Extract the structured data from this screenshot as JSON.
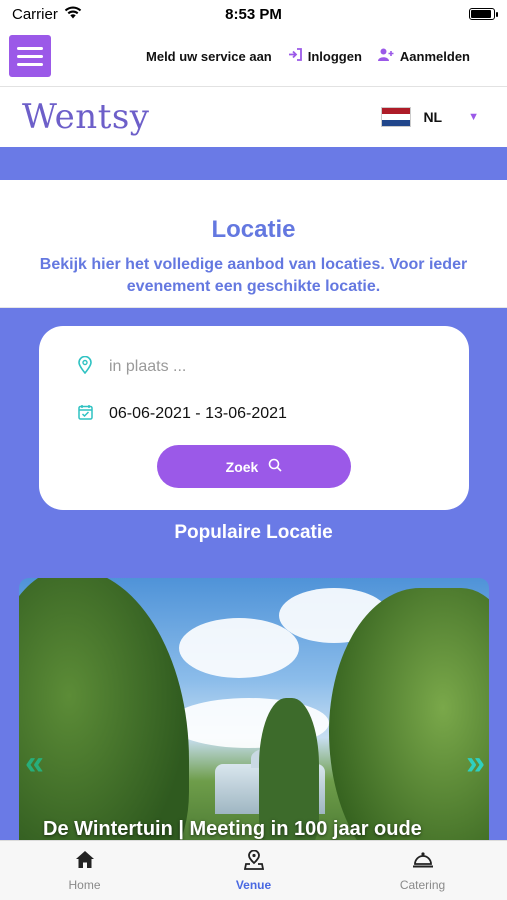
{
  "status_bar": {
    "carrier": "Carrier",
    "time": "8:53 PM",
    "wifi_icon": "wifi-icon",
    "battery_level": 0.9
  },
  "top_bar": {
    "menu_icon": "hamburger-menu-icon",
    "service_label": "Meld uw service aan",
    "login_label": "Inloggen",
    "login_icon": "login-arrow-icon",
    "register_label": "Aanmelden",
    "register_icon": "user-plus-icon"
  },
  "header": {
    "logo_text": "Wentsy",
    "language": "NL",
    "flag_colors": [
      "#AE1C28",
      "#FFFFFF",
      "#21468B"
    ],
    "dropdown_icon": "caret-down-icon"
  },
  "hero": {
    "title": "Locatie",
    "subtitle": "Bekijk hier het volledige aanbod van locaties. Voor ieder evenement een geschikte locatie."
  },
  "search": {
    "place_placeholder": "in plaats ...",
    "place_icon": "map-pin-icon",
    "date_range": "06-06-2021 - 13-06-2021",
    "date_icon": "calendar-check-icon",
    "button_label": "Zoek",
    "button_icon": "search-icon"
  },
  "popular": {
    "title": "Populaire Locatie",
    "venue_name": "De Wintertuin | Meeting in 100 jaar oude",
    "prev_icon": "double-chevron-left-icon",
    "next_icon": "double-chevron-right-icon"
  },
  "tab_bar": {
    "tabs": [
      {
        "label": "Home",
        "icon": "home-icon",
        "active": false
      },
      {
        "label": "Venue",
        "icon": "map-location-icon",
        "active": true
      },
      {
        "label": "Catering",
        "icon": "cloche-icon",
        "active": false
      }
    ]
  },
  "colors": {
    "accent_purple": "#9b59e8",
    "primary_blue": "#6a7ae6",
    "title_blue": "#6478e0",
    "active_tab": "#4a69e2",
    "input_icon_teal": "#2fc2c2"
  }
}
